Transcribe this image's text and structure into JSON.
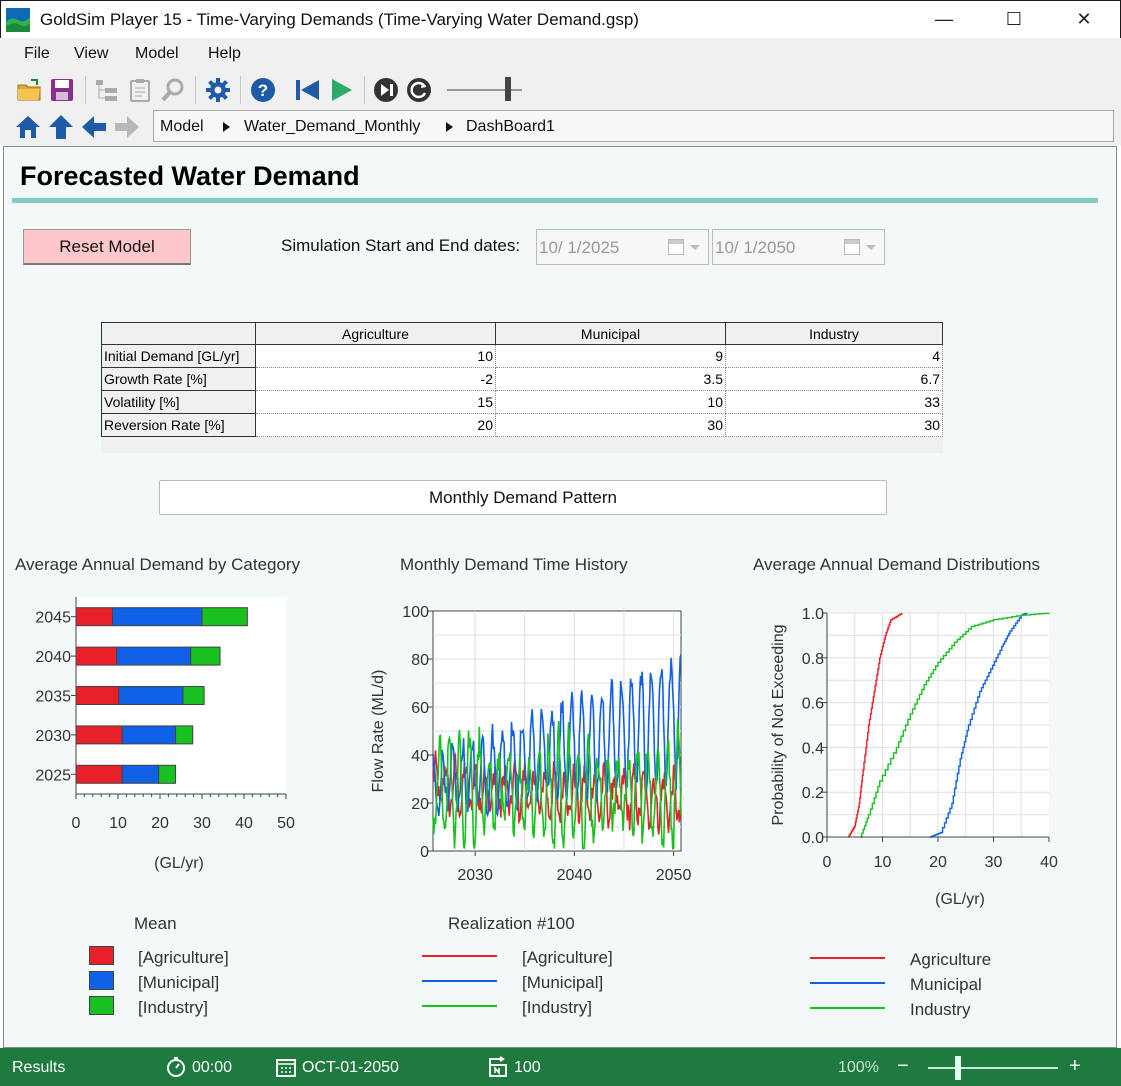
{
  "window": {
    "title": "GoldSim Player 15  - Time-Varying Demands (Time-Varying Water Demand.gsp)",
    "minimize": "—",
    "maximize": "☐",
    "close": "✕"
  },
  "menu": [
    "File",
    "View",
    "Model",
    "Help"
  ],
  "toolbar": {
    "icons": [
      "open-folder-icon",
      "save-icon",
      "tree-view-icon",
      "clipboard-icon",
      "search-icon",
      "gear-icon",
      "help-icon",
      "rewind-icon",
      "play-icon",
      "step-icon",
      "reset-run-icon"
    ],
    "slider_label": "speed-slider"
  },
  "nav": {
    "breadcrumb": [
      "Model",
      "Water_Demand_Monthly",
      "DashBoard1"
    ]
  },
  "dashboard": {
    "title": "Forecasted Water Demand",
    "reset_label": "Reset Model",
    "sim_label": "Simulation Start and End dates:",
    "start_date": "10/  1/2025",
    "end_date": "10/  1/2050",
    "pattern_button": "Monthly Demand Pattern"
  },
  "param_table": {
    "columns": [
      "",
      "Agriculture",
      "Municipal",
      "Industry"
    ],
    "rows": [
      {
        "label": "Initial Demand [GL/yr]",
        "values": [
          "10",
          "9",
          "4"
        ]
      },
      {
        "label": "Growth Rate [%]",
        "values": [
          "-2",
          "3.5",
          "6.7"
        ]
      },
      {
        "label": "Volatility [%]",
        "values": [
          "15",
          "10",
          "33"
        ]
      },
      {
        "label": "Reversion Rate [%]",
        "values": [
          "20",
          "30",
          "30"
        ]
      }
    ]
  },
  "colors": {
    "agriculture": "#e8202a",
    "municipal": "#1060e8",
    "industry": "#18c020"
  },
  "chart_data": [
    {
      "type": "bar",
      "orientation": "horizontal",
      "stacked": true,
      "title": "Average Annual Demand by Category",
      "xlabel": "(GL/yr)",
      "categories": [
        "2045",
        "2040",
        "2035",
        "2030",
        "2025"
      ],
      "xlim": [
        0,
        50
      ],
      "xticks": [
        "0",
        "10",
        "20",
        "30",
        "40",
        "50"
      ],
      "series": [
        {
          "name": "[Agriculture]",
          "values": [
            8.7,
            9.7,
            10.2,
            11.0,
            11.0
          ]
        },
        {
          "name": "[Municipal]",
          "values": [
            21.3,
            17.6,
            15.3,
            12.7,
            8.7
          ]
        },
        {
          "name": "[Industry]",
          "values": [
            10.8,
            7.0,
            5.0,
            4.1,
            4.0
          ]
        }
      ],
      "legend_title": "Mean"
    },
    {
      "type": "line",
      "title": "Monthly Demand Time History",
      "ylabel": "Flow Rate (ML/d)",
      "ylim": [
        0,
        100
      ],
      "yticks": [
        "0",
        "20",
        "40",
        "60",
        "80",
        "100"
      ],
      "xlim": [
        2025.75,
        2050.75
      ],
      "xticks": [
        "2030",
        "2040",
        "2050"
      ],
      "legend_title": "Realization #100",
      "series_names": [
        "[Agriculture]",
        "[Municipal]",
        "[Industry]"
      ]
    },
    {
      "type": "line",
      "title": "Average Annual Demand Distributions",
      "ylabel": "Probability of Not Exceeding",
      "xlabel": "(GL/yr)",
      "xlim": [
        0,
        40
      ],
      "ylim": [
        0,
        1
      ],
      "xticks": [
        "0",
        "10",
        "20",
        "30",
        "40"
      ],
      "yticks": [
        "0.0",
        "0.2",
        "0.4",
        "0.6",
        "0.8",
        "1.0"
      ],
      "series": [
        {
          "name": "Agriculture",
          "points": [
            [
              3.8,
              0.0
            ],
            [
              5.0,
              0.05
            ],
            [
              5.8,
              0.15
            ],
            [
              6.5,
              0.3
            ],
            [
              7.5,
              0.5
            ],
            [
              8.5,
              0.65
            ],
            [
              9.5,
              0.8
            ],
            [
              10.5,
              0.9
            ],
            [
              11.5,
              0.97
            ],
            [
              13.5,
              1.0
            ]
          ]
        },
        {
          "name": "Municipal",
          "points": [
            [
              18.5,
              0.0
            ],
            [
              20.5,
              0.02
            ],
            [
              22.5,
              0.15
            ],
            [
              24,
              0.35
            ],
            [
              25.5,
              0.5
            ],
            [
              27.5,
              0.65
            ],
            [
              29.5,
              0.75
            ],
            [
              31.5,
              0.85
            ],
            [
              33,
              0.92
            ],
            [
              35,
              0.99
            ],
            [
              36,
              1.0
            ]
          ]
        },
        {
          "name": "Industry",
          "points": [
            [
              6.0,
              0.0
            ],
            [
              7.5,
              0.1
            ],
            [
              9.5,
              0.25
            ],
            [
              12.5,
              0.4
            ],
            [
              15,
              0.55
            ],
            [
              17.5,
              0.68
            ],
            [
              20,
              0.78
            ],
            [
              23,
              0.87
            ],
            [
              26,
              0.94
            ],
            [
              30,
              0.97
            ],
            [
              35,
              0.99
            ],
            [
              40,
              1.0
            ]
          ]
        }
      ]
    }
  ],
  "status": {
    "mode": "Results",
    "time": "00:00",
    "date": "OCT-01-2050",
    "realizations": "100",
    "zoom": "100%",
    "zoom_minus": "−",
    "zoom_plus": "+"
  }
}
